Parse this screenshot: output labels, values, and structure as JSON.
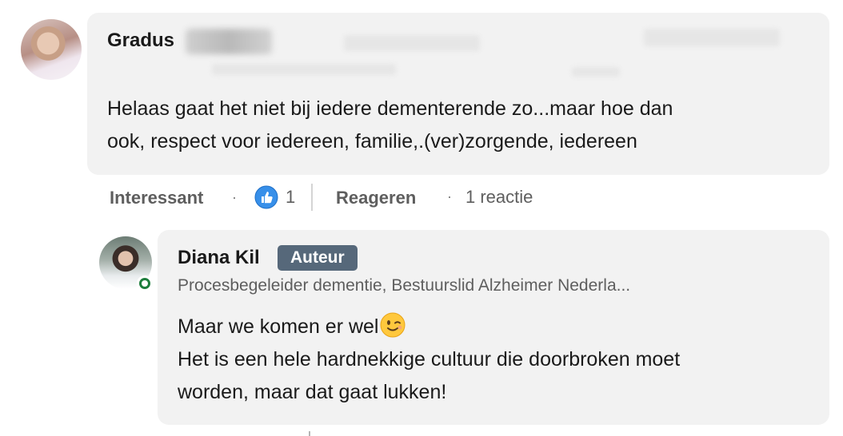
{
  "comment": {
    "author_name": "Gradus",
    "text_lines": [
      "Helaas gaat het niet bij iedere dementerende zo...maar hoe dan",
      "ook, respect voor iedereen, familie,.(ver)zorgende, iedereen"
    ],
    "actions": {
      "interesting_label": "Interessant",
      "reaction_count": "1",
      "reply_label": "Reageren",
      "replies_count_label": "1 reactie"
    }
  },
  "reply": {
    "author_name": "Diana Kil",
    "badge": "Auteur",
    "headline": "Procesbegeleider dementie, Bestuurslid Alzheimer Nederla...",
    "line1": "Maar we komen er wel",
    "line2": "Het is een hele hardnekkige cultuur die doorbroken moet",
    "line3": "worden, maar dat gaat lukken!",
    "emoji": "winking-face",
    "online_status": "online"
  },
  "colors": {
    "bubble_bg": "#f2f2f2",
    "badge_bg": "#56687a",
    "online_green": "#1e7d3d",
    "like_blue": "#378fe9",
    "muted_text": "#5e5e5e"
  }
}
